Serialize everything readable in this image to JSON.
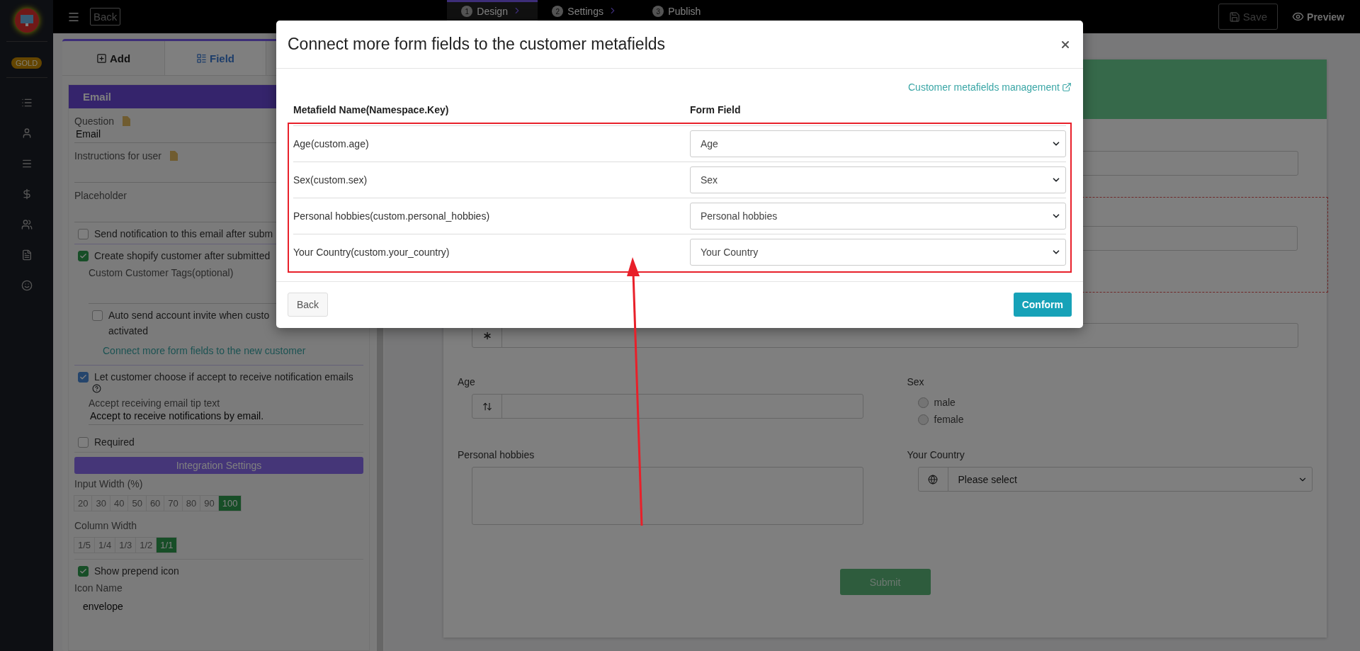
{
  "sidebar": {
    "badge": "GOLD"
  },
  "topbar": {
    "back": "Back",
    "steps": [
      {
        "number": "1",
        "label": "Design",
        "selected": true
      },
      {
        "number": "2",
        "label": "Settings",
        "selected": false
      },
      {
        "number": "3",
        "label": "Publish",
        "selected": false
      }
    ],
    "save": "Save",
    "preview": "Preview"
  },
  "panel": {
    "tabs": [
      {
        "label": "Add",
        "selected": false
      },
      {
        "label": "Field",
        "selected": true
      }
    ],
    "section_title": "Email",
    "question_label": "Question",
    "question_value": "Email",
    "instructions_label": "Instructions for user",
    "placeholder_label": "Placeholder",
    "notify": {
      "label": "Send notification to this email after subm",
      "checked": false
    },
    "create_customer": {
      "label": "Create shopify customer after submitted",
      "checked": true
    },
    "tags_label": "Custom Customer Tags(optional)",
    "auto_invite": {
      "label": "Auto send account invite when custo",
      "label_line2": "activated",
      "checked": false
    },
    "connect_link": "Connect more form fields to the new customer",
    "let_choose": {
      "label": "Let customer choose if accept to receive notification emails",
      "checked": true
    },
    "tip_label": "Accept receiving email tip text",
    "tip_value": "Accept to receive notifications by email.",
    "required": {
      "label": "Required",
      "checked": false
    },
    "integration_title": "Integration Settings",
    "input_width": {
      "label": "Input Width (%)",
      "options": [
        {
          "label": "20",
          "selected": false
        },
        {
          "label": "30",
          "selected": false
        },
        {
          "label": "40",
          "selected": false
        },
        {
          "label": "50",
          "selected": false
        },
        {
          "label": "60",
          "selected": false
        },
        {
          "label": "70",
          "selected": false
        },
        {
          "label": "80",
          "selected": false
        },
        {
          "label": "90",
          "selected": false
        },
        {
          "label": "100",
          "selected": true
        }
      ]
    },
    "column_width": {
      "label": "Column Width",
      "options": [
        {
          "label": "1/5",
          "selected": false
        },
        {
          "label": "1/4",
          "selected": false
        },
        {
          "label": "1/3",
          "selected": false
        },
        {
          "label": "1/2",
          "selected": false
        },
        {
          "label": "1/1",
          "selected": true
        }
      ]
    },
    "show_icon": {
      "label": "Show prepend icon",
      "checked": true
    },
    "icon_name_label": "Icon Name",
    "icon_name_value": "envelope"
  },
  "form": {
    "age_label": "Age",
    "sex_label": "Sex",
    "sex_options": [
      {
        "label": "male",
        "selected": false
      },
      {
        "label": "female",
        "selected": false
      }
    ],
    "hobbies_label": "Personal hobbies",
    "country_label": "Your Country",
    "country_value": "Please select",
    "submit": "Submit"
  },
  "modal": {
    "title": "Connect more form fields to the customer metafields",
    "link": "Customer metafields management",
    "columns": [
      "Metafield Name(Namespace.Key)",
      "Form Field"
    ],
    "rows": [
      {
        "name": "Age(custom.age)",
        "field": "Age"
      },
      {
        "name": "Sex(custom.sex)",
        "field": "Sex"
      },
      {
        "name": "Personal hobbies(custom.personal_hobbies)",
        "field": "Personal hobbies"
      },
      {
        "name": "Your Country(custom.your_country)",
        "field": "Your Country"
      }
    ],
    "back": "Back",
    "confirm": "Conform"
  }
}
